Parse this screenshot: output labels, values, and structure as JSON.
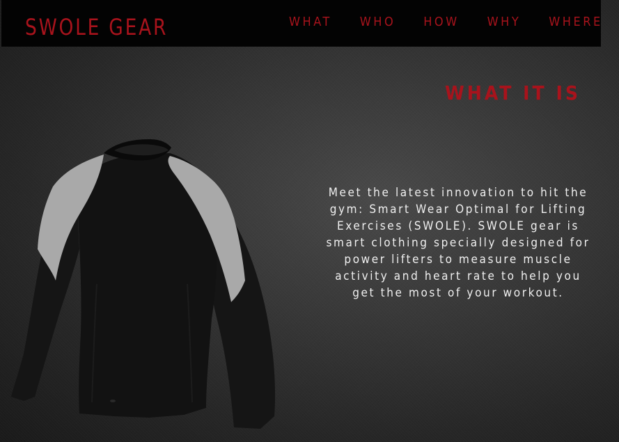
{
  "nav": {
    "brand": "SWOLE GEAR",
    "links": [
      {
        "label": "WHAT"
      },
      {
        "label": "WHO"
      },
      {
        "label": "HOW"
      },
      {
        "label": "WHY"
      },
      {
        "label": "WHERE"
      }
    ]
  },
  "hero": {
    "title": "WHAT IT IS",
    "description": "Meet the latest innovation to hit the gym: Smart Wear Optimal for Lifting Exercises (SWOLE). SWOLE gear is smart clothing specially designed for power lifters to measure muscle activity and heart rate to help you get the most of your workout."
  },
  "colors": {
    "accent": "#a8131c",
    "navbar": "#030303",
    "text": "#f0f0f0",
    "background": "#383838"
  }
}
